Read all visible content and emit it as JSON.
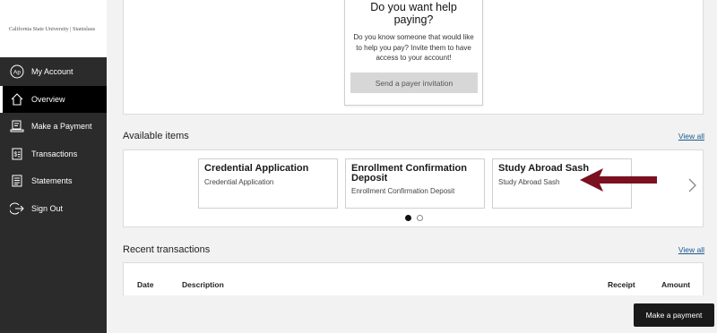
{
  "brand": {
    "logo_text": "California State University | Stanislaus"
  },
  "sidebar": {
    "items": [
      {
        "label": "My Account",
        "icon": "user-circle-icon"
      },
      {
        "label": "Overview",
        "icon": "home-icon"
      },
      {
        "label": "Make a Payment",
        "icon": "payment-icon"
      },
      {
        "label": "Transactions",
        "icon": "transactions-icon"
      },
      {
        "label": "Statements",
        "icon": "statements-icon"
      },
      {
        "label": "Sign Out",
        "icon": "sign-out-icon"
      }
    ],
    "account_initials": "Ap",
    "active_item": "Overview"
  },
  "payer": {
    "title": "Do you want help paying?",
    "description": "Do you know someone that would like to help you pay? Invite them to have access to your account!",
    "button_label": "Send a payer invitation"
  },
  "available_items": {
    "heading": "Available items",
    "view_all": "View all",
    "items": [
      {
        "title": "Credential Application",
        "subtitle": "Credential Application"
      },
      {
        "title": "Enrollment Confirmation Deposit",
        "subtitle": "Enrollment Confirmation Deposit"
      },
      {
        "title": "Study Abroad Sash",
        "subtitle": "Study Abroad Sash"
      }
    ],
    "page_count": 2,
    "current_page": 1
  },
  "recent_transactions": {
    "heading": "Recent transactions",
    "view_all": "View all",
    "columns": [
      "Date",
      "Description",
      "Receipt",
      "Amount"
    ]
  },
  "actions": {
    "make_payment": "Make a payment"
  },
  "colors": {
    "sidebar_bg": "#2b2b2b",
    "link": "#1b5a91",
    "arrow": "#7a1020"
  }
}
